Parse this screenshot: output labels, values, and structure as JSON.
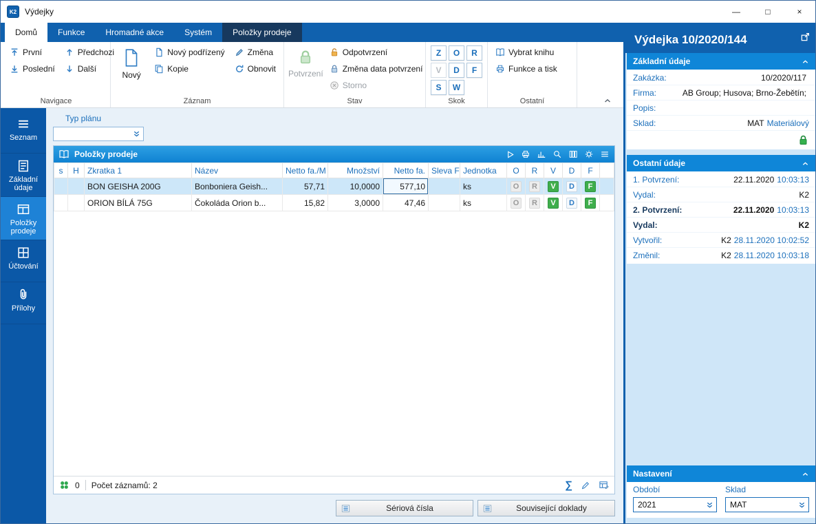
{
  "window": {
    "title": "Výdejky",
    "controls": {
      "minimize": "—",
      "maximize": "□",
      "close": "×"
    }
  },
  "tabs": {
    "items": [
      {
        "label": "Domů"
      },
      {
        "label": "Funkce"
      },
      {
        "label": "Hromadné akce"
      },
      {
        "label": "Systém"
      },
      {
        "label": "Položky prodeje"
      }
    ]
  },
  "ribbon": {
    "navigace": {
      "first": "První",
      "last": "Poslední",
      "previous": "Předchozi",
      "next": "Další",
      "group_label": "Navigace"
    },
    "zaznam": {
      "new": "Nový",
      "new_child": "Nový podřízený",
      "copy": "Kopie",
      "change": "Změna",
      "refresh": "Obnovit",
      "group_label": "Záznam"
    },
    "stav": {
      "confirm": "Potvrzení",
      "unconfirm": "Odpotvrzení",
      "change_date": "Změna data potvrzení",
      "storno": "Storno",
      "group_label": "Stav"
    },
    "skok": {
      "letters": [
        "Z",
        "O",
        "R",
        "V",
        "D",
        "F",
        "S",
        "W"
      ],
      "group_label": "Skok"
    },
    "ostatni": {
      "select_book": "Vybrat knihu",
      "functions_print": "Funkce a tisk",
      "group_label": "Ostatní"
    }
  },
  "sidebar": {
    "items": [
      {
        "label": "Seznam"
      },
      {
        "label": "Základní údaje"
      },
      {
        "label": "Položky prodeje"
      },
      {
        "label": "Účtování"
      },
      {
        "label": "Přílohy"
      }
    ]
  },
  "content": {
    "typ_planu_label": "Typ plánu",
    "typ_planu_value": "",
    "panel_title": "Položky prodeje",
    "table": {
      "columns": [
        "s",
        "H",
        "Zkratka 1",
        "Název",
        "Netto fa./M",
        "Množství",
        "Netto fa.",
        "Sleva F",
        "Jednotka",
        "O",
        "R",
        "V",
        "D",
        "F"
      ],
      "rows": [
        {
          "zkratka": "BON GEISHA 200G",
          "nazev": "Bonboniera Geish...",
          "netto_fa_m": "57,71",
          "mnozstvi": "10,0000",
          "netto_fa": "577,10",
          "sleva_f": "",
          "jednotka": "ks"
        },
        {
          "zkratka": "ORION BÍLÁ 75G",
          "nazev": "Čokoláda Orion b...",
          "netto_fa_m": "15,82",
          "mnozstvi": "3,0000",
          "netto_fa": "47,46",
          "sleva_f": "",
          "jednotka": "ks"
        }
      ],
      "badges": [
        "O",
        "R",
        "V",
        "D",
        "F"
      ]
    },
    "status": {
      "counter": "0",
      "records": "Počet záznamů: 2"
    },
    "footer_buttons": {
      "serial_numbers": "Sériová čísla",
      "related_documents": "Související doklady"
    }
  },
  "detail": {
    "title": "Výdejka 10/2020/144",
    "zakladni_udaje": {
      "header": "Základní údaje",
      "fields": [
        {
          "label": "Zakázka:",
          "value": "10/2020/117",
          "value_blue": ""
        },
        {
          "label": "Firma:",
          "value": "AB Group; Husova; Brno-Žebětín;",
          "value_blue": ""
        },
        {
          "label": "Popis:",
          "value": "",
          "value_blue": ""
        },
        {
          "label": "Sklad:",
          "value": "MAT",
          "value_blue": "Materiálový"
        }
      ]
    },
    "ostatni_udaje": {
      "header": "Ostatní údaje",
      "fields": [
        {
          "label": "1. Potvrzení:",
          "value": "22.11.2020",
          "value_blue": "10:03:13"
        },
        {
          "label": "Vydal:",
          "value": "K2",
          "value_blue": ""
        },
        {
          "label": "2. Potvrzení:",
          "value": "22.11.2020",
          "value_blue": "10:03:13"
        },
        {
          "label": "Vydal:",
          "value": "K2",
          "value_blue": ""
        },
        {
          "label": "Vytvořil:",
          "value": "K2",
          "value_blue": "28.11.2020 10:02:52"
        },
        {
          "label": "Změnil:",
          "value": "K2",
          "value_blue": "28.11.2020 10:03:18"
        }
      ]
    },
    "nastaveni": {
      "header": "Nastavení",
      "obdobi_label": "Období",
      "obdobi_value": "2021",
      "sklad_label": "Sklad",
      "sklad_value": "MAT"
    }
  }
}
